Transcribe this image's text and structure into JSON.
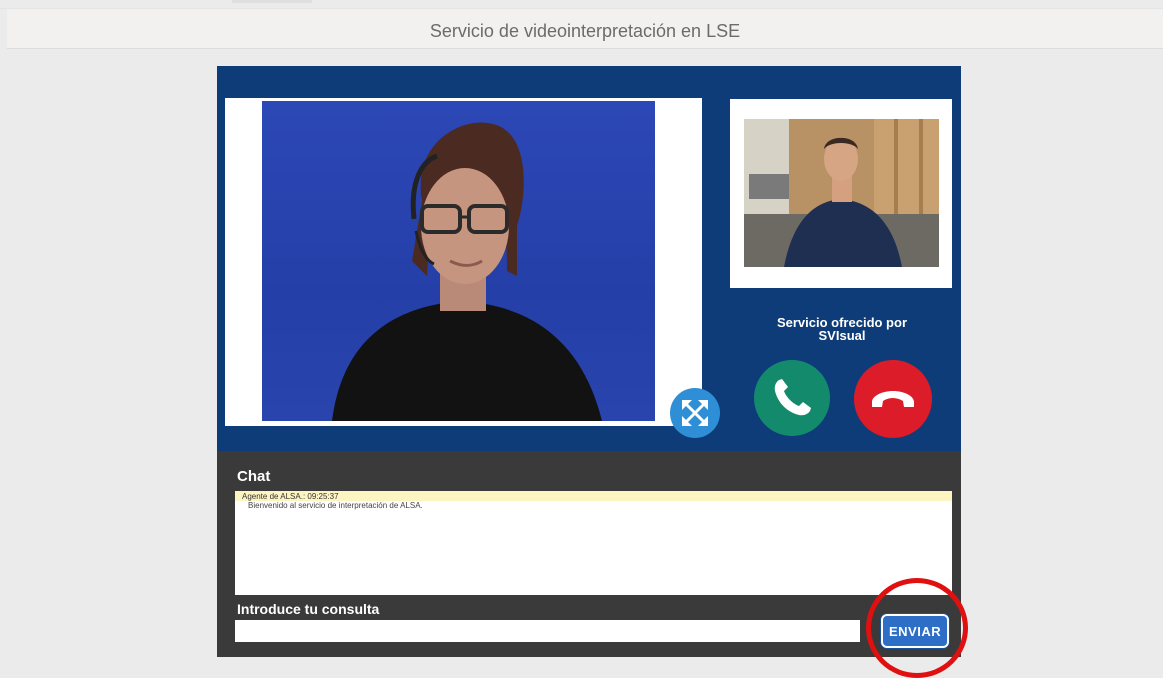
{
  "header": {
    "title": "Servicio de videointerpretación en LSE"
  },
  "video": {
    "provider_line1": "Servicio ofrecido por",
    "provider_line2": "SVIsual"
  },
  "chat": {
    "title": "Chat",
    "messages": [
      {
        "sender_time": "Agente de ALSA.: 09:25:37",
        "text": "Bienvenido al servicio de interpretación de ALSA."
      }
    ]
  },
  "query": {
    "label": "Introduce tu consulta",
    "value": "",
    "send_label": "ENVIAR"
  },
  "colors": {
    "panel": "#0d3c78",
    "call_button": "#148a6d",
    "hangup_button": "#dd1c2a",
    "send_button": "#2d6fc7",
    "highlight": "#e01010"
  },
  "icons": [
    "expand-icon",
    "phone-icon",
    "hangup-icon"
  ]
}
